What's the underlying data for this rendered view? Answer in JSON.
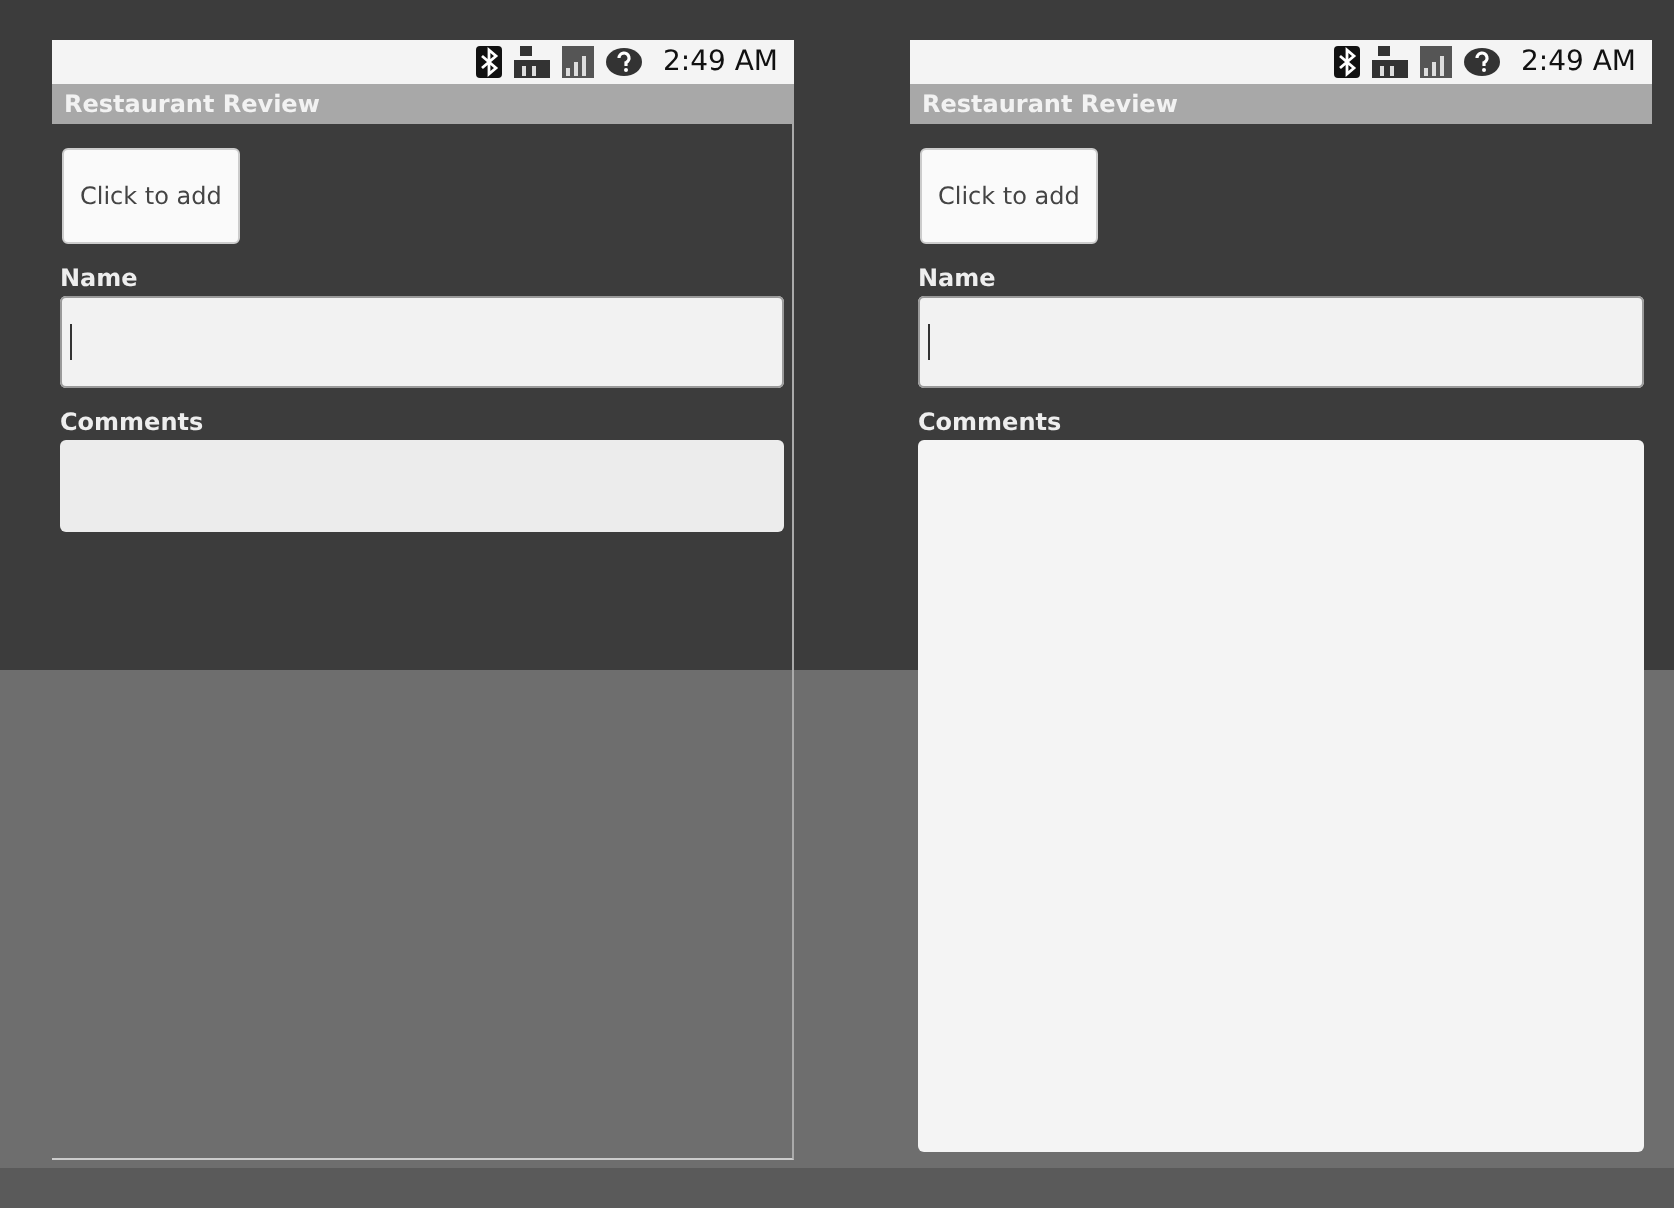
{
  "screens": [
    {
      "status_bar": {
        "time": "2:49 AM"
      },
      "title": "Restaurant Review",
      "add_button": "Click to add",
      "fields": [
        {
          "label": "Name",
          "focused": true,
          "expanded": false
        },
        {
          "label": "Comments",
          "focused": false,
          "expanded": false
        }
      ]
    },
    {
      "status_bar": {
        "time": "2:49 AM"
      },
      "title": "Restaurant Review",
      "add_button": "Click to add",
      "fields": [
        {
          "label": "Name",
          "focused": true,
          "expanded": false
        },
        {
          "label": "Comments",
          "focused": false,
          "expanded": true
        }
      ]
    }
  ]
}
